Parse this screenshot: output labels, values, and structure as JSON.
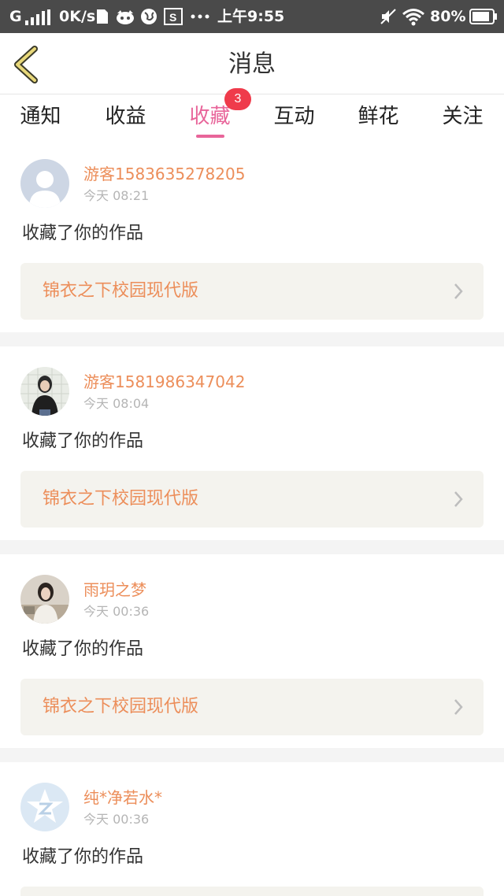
{
  "status_bar": {
    "network": "G",
    "speed": "0K/s",
    "time": "上午9:55",
    "battery": "80%"
  },
  "nav": {
    "title": "消息",
    "back_icon": "chevron-left-icon"
  },
  "tabs": [
    {
      "label": "通知",
      "active": false
    },
    {
      "label": "收益",
      "active": false
    },
    {
      "label": "收藏",
      "active": true
    },
    {
      "label": "互动",
      "active": false
    },
    {
      "label": "鲜花",
      "active": false
    },
    {
      "label": "关注",
      "active": false
    }
  ],
  "badge": "3",
  "colors": {
    "accent": "#e8659a",
    "username": "#ec8e5a",
    "badge": "#ef3b4b"
  },
  "items": [
    {
      "user": "游客1583635278205",
      "time": "今天 08:21",
      "action": "收藏了你的作品",
      "work": "锦衣之下校园现代版"
    },
    {
      "user": "游客1581986347042",
      "time": "今天 08:04",
      "action": "收藏了你的作品",
      "work": "锦衣之下校园现代版"
    },
    {
      "user": "雨玥之梦",
      "time": "今天 00:36",
      "action": "收藏了你的作品",
      "work": "锦衣之下校园现代版"
    },
    {
      "user": "纯*净若水*",
      "time": "今天 00:36",
      "action": "收藏了你的作品",
      "work": ""
    }
  ]
}
